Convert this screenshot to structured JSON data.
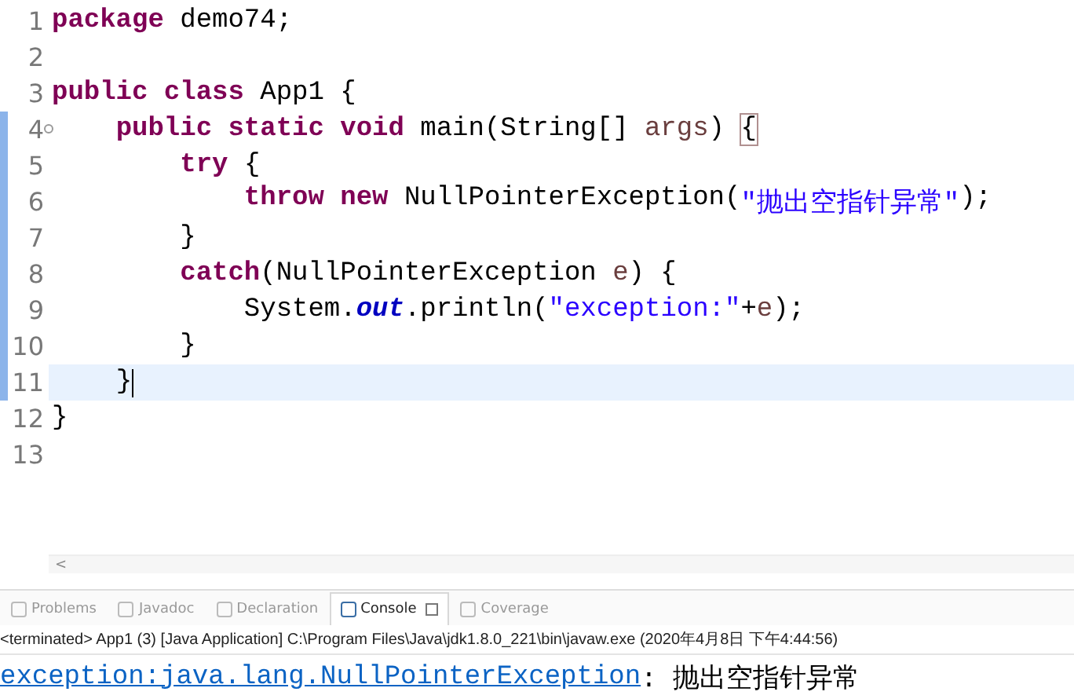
{
  "editor": {
    "lines": [
      {
        "number": "1",
        "current": false,
        "range": false,
        "foldable": false,
        "tokens": [
          {
            "kind": "keyword",
            "text": "package "
          },
          {
            "kind": "plain",
            "text": "demo74;"
          }
        ]
      },
      {
        "number": "2",
        "current": false,
        "range": false,
        "foldable": false
      },
      {
        "number": "3",
        "current": false,
        "range": false,
        "foldable": false,
        "tokens": [
          {
            "kind": "keyword",
            "text": "public class "
          },
          {
            "kind": "plain",
            "text": "App1 {"
          }
        ]
      },
      {
        "number": "4",
        "current": false,
        "range": true,
        "foldable": true,
        "tokens": [
          {
            "kind": "keyword",
            "text": "\tpublic static void "
          },
          {
            "kind": "plain",
            "text": "main(String[] "
          },
          {
            "kind": "local",
            "text": "args"
          },
          {
            "kind": "plain",
            "text": ") "
          },
          {
            "kind": "match",
            "text": "{"
          }
        ]
      },
      {
        "number": "5",
        "current": false,
        "range": true,
        "foldable": false,
        "tokens": [
          {
            "kind": "keyword",
            "text": "\t\ttry "
          },
          {
            "kind": "plain",
            "text": "{"
          }
        ]
      },
      {
        "number": "6",
        "current": false,
        "range": true,
        "foldable": false,
        "tokens": [
          {
            "kind": "keyword",
            "text": "\t\t\tthrow new "
          },
          {
            "kind": "plain",
            "text": "NullPointerException("
          },
          {
            "kind": "string",
            "text": "\"抛出空指针异常\""
          },
          {
            "kind": "plain",
            "text": ");"
          }
        ]
      },
      {
        "number": "7",
        "current": false,
        "range": true,
        "foldable": false,
        "tokens": [
          {
            "kind": "plain",
            "text": "\t\t}"
          }
        ]
      },
      {
        "number": "8",
        "current": false,
        "range": true,
        "foldable": false,
        "tokens": [
          {
            "kind": "keyword",
            "text": "\t\tcatch"
          },
          {
            "kind": "plain",
            "text": "(NullPointerException "
          },
          {
            "kind": "local",
            "text": "e"
          },
          {
            "kind": "plain",
            "text": ") {"
          }
        ]
      },
      {
        "number": "9",
        "current": false,
        "range": true,
        "foldable": false,
        "tokens": [
          {
            "kind": "plain",
            "text": "\t\t\tSystem."
          },
          {
            "kind": "field",
            "text": "out"
          },
          {
            "kind": "plain",
            "text": ".println("
          },
          {
            "kind": "string",
            "text": "\"exception:\""
          },
          {
            "kind": "plain",
            "text": "+"
          },
          {
            "kind": "local",
            "text": "e"
          },
          {
            "kind": "plain",
            "text": ");"
          }
        ]
      },
      {
        "number": "10",
        "current": false,
        "range": true,
        "foldable": false,
        "tokens": [
          {
            "kind": "plain",
            "text": "\t\t}"
          }
        ]
      },
      {
        "number": "11",
        "current": true,
        "range": true,
        "foldable": false,
        "tokens": [
          {
            "kind": "plain",
            "text": "\t}"
          }
        ]
      },
      {
        "number": "12",
        "current": false,
        "range": false,
        "foldable": false,
        "tokens": [
          {
            "kind": "plain",
            "text": "}"
          }
        ]
      },
      {
        "number": "13",
        "current": false,
        "range": false,
        "foldable": false
      }
    ]
  },
  "scroll_left": "<",
  "tabs": [
    {
      "label": "Problems",
      "selected": false
    },
    {
      "label": "Javadoc",
      "selected": false
    },
    {
      "label": "Declaration",
      "selected": false
    },
    {
      "label": "Console",
      "selected": true
    },
    {
      "label": "Coverage",
      "selected": false
    }
  ],
  "console": {
    "header": "<terminated> App1 (3) [Java Application] C:\\Program Files\\Java\\jdk1.8.0_221\\bin\\javaw.exe (2020年4月8日 下午4:44:56)",
    "output_link": "exception:java.lang.NullPointerException",
    "output_text": ": 抛出空指针异常"
  }
}
